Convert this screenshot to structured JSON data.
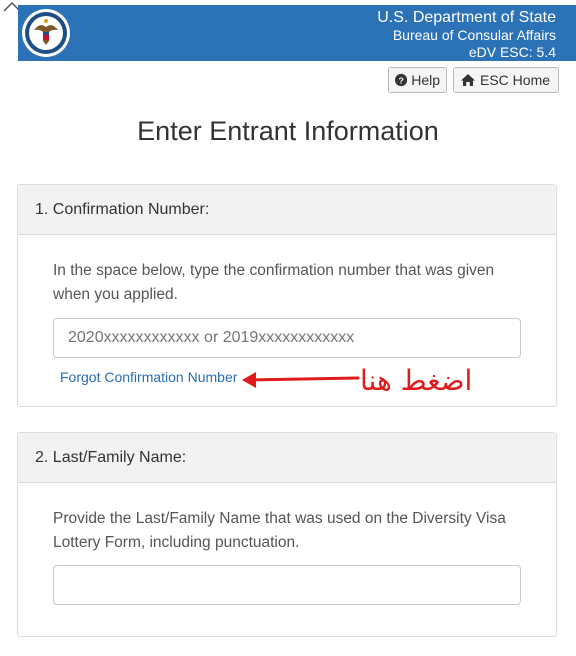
{
  "header": {
    "department": "U.S. Department of State",
    "bureau": "Bureau of Consular Affairs",
    "version": "eDV ESC: 5.4",
    "colors": {
      "banner": "#2c72b7",
      "text": "#ffffff"
    }
  },
  "toolbar": {
    "help_label": "Help",
    "help_icon": "question-circle-icon",
    "home_label": "ESC Home",
    "home_icon": "home-icon"
  },
  "page": {
    "title": "Enter Entrant Information"
  },
  "section1": {
    "heading": "1. Confirmation Number:",
    "instructions": "In the space below, type the confirmation number that was given when you applied.",
    "input_placeholder": "2020xxxxxxxxxxxx or 2019xxxxxxxxxxxx",
    "forgot_link": "Forgot Confirmation Number"
  },
  "annotation": {
    "text": "اضغط هنا",
    "color": "#e01b1b"
  },
  "section2": {
    "heading": "2. Last/Family Name:",
    "instructions": "Provide the Last/Family Name that was used on the Diversity Visa Lottery Form, including punctuation.",
    "input_value": ""
  }
}
